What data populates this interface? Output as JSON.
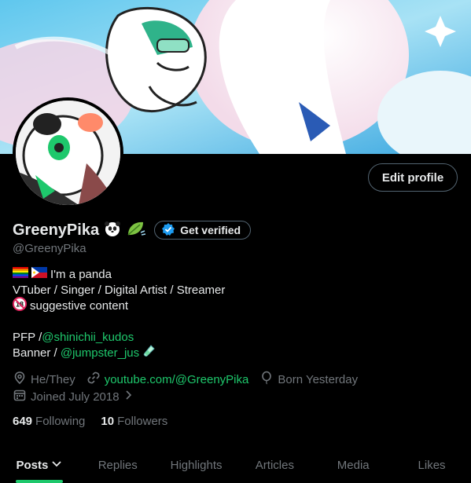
{
  "profile": {
    "display_name": "GreenyPika",
    "handle": "@GreenyPika",
    "name_emojis": [
      "panda-emoji",
      "leaf-emoji"
    ],
    "get_verified_label": "Get verified",
    "edit_profile_label": "Edit profile"
  },
  "bio": {
    "line1_text": "I'm a panda",
    "line2_text": "VTuber / Singer / Digital Artist / Streamer",
    "line3_text": "suggestive content",
    "pfp_prefix": "PFP /",
    "pfp_link": "@shinichii_kudos",
    "banner_prefix": "Banner / ",
    "banner_link": "@jumpster_jus"
  },
  "meta": {
    "pronouns": "He/They",
    "website": "youtube.com/@GreenyPika",
    "born": "Born Yesterday",
    "joined": "Joined July 2018"
  },
  "stats": {
    "following_count": "649",
    "following_label": "Following",
    "followers_count": "10",
    "followers_label": "Followers"
  },
  "tabs": [
    {
      "label": "Posts",
      "active": true
    },
    {
      "label": "Replies",
      "active": false
    },
    {
      "label": "Highlights",
      "active": false
    },
    {
      "label": "Articles",
      "active": false
    },
    {
      "label": "Media",
      "active": false
    },
    {
      "label": "Likes",
      "active": false
    }
  ],
  "colors": {
    "background": "#000000",
    "text_primary": "#e7e9ea",
    "text_secondary": "#71767b",
    "accent_green": "#1ec86c",
    "border": "#536471",
    "verified_blue": "#1d9bf0"
  }
}
